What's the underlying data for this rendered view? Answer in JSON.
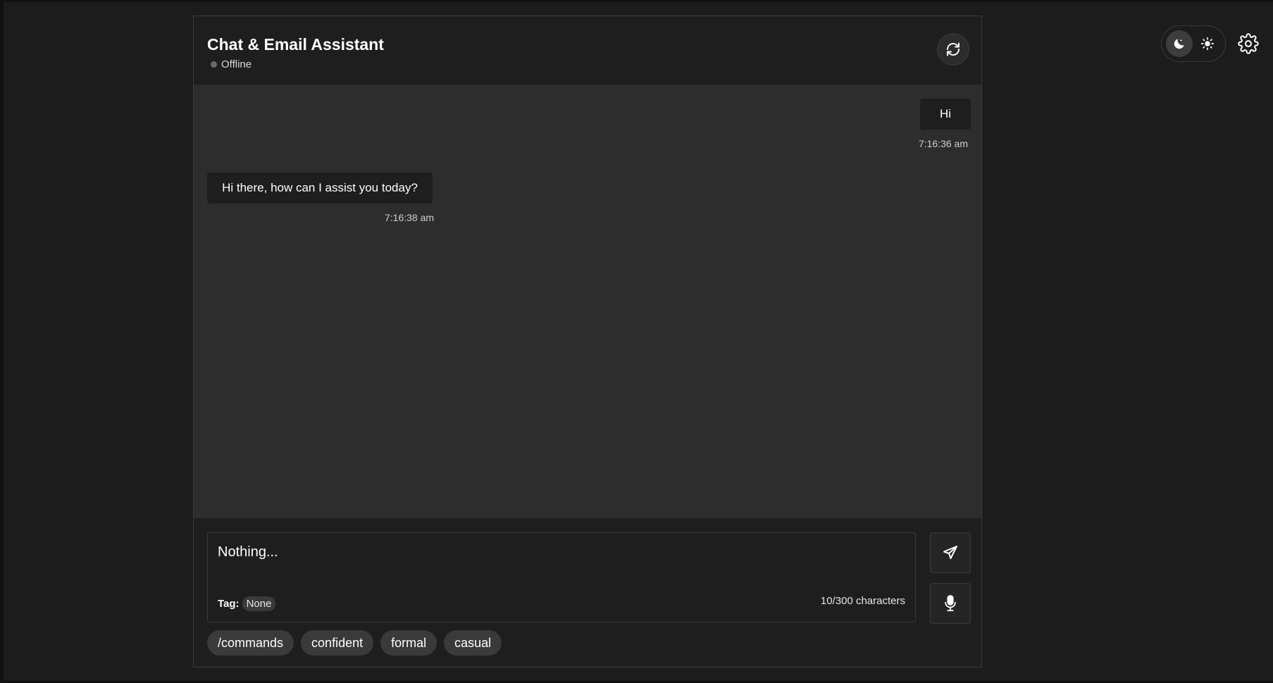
{
  "header": {
    "title": "Chat & Email Assistant",
    "status": "Offline",
    "refresh_icon": "refresh-icon"
  },
  "theme": {
    "dark_icon": "moon-icon",
    "light_icon": "sun-icon",
    "selected": "dark"
  },
  "settings_icon": "gear-icon",
  "messages": [
    {
      "role": "user",
      "text": "Hi",
      "time": "7:16:36 am"
    },
    {
      "role": "assistant",
      "text": "Hi there, how can I assist you today?",
      "time": "7:16:38 am"
    }
  ],
  "composer": {
    "input_value": "Nothing...",
    "tag_label": "Tag:",
    "tag_value": "None",
    "char_count": "10/300 characters",
    "send_icon": "send-icon",
    "mic_icon": "microphone-icon"
  },
  "chips": [
    "/commands",
    "confident",
    "formal",
    "casual"
  ],
  "colors": {
    "background": "#1c1c1c",
    "panel": "#1e1e1e",
    "messages_area": "#2d2d2d",
    "chip": "#3a3a3a",
    "status_dot": "#6b6b6b"
  }
}
